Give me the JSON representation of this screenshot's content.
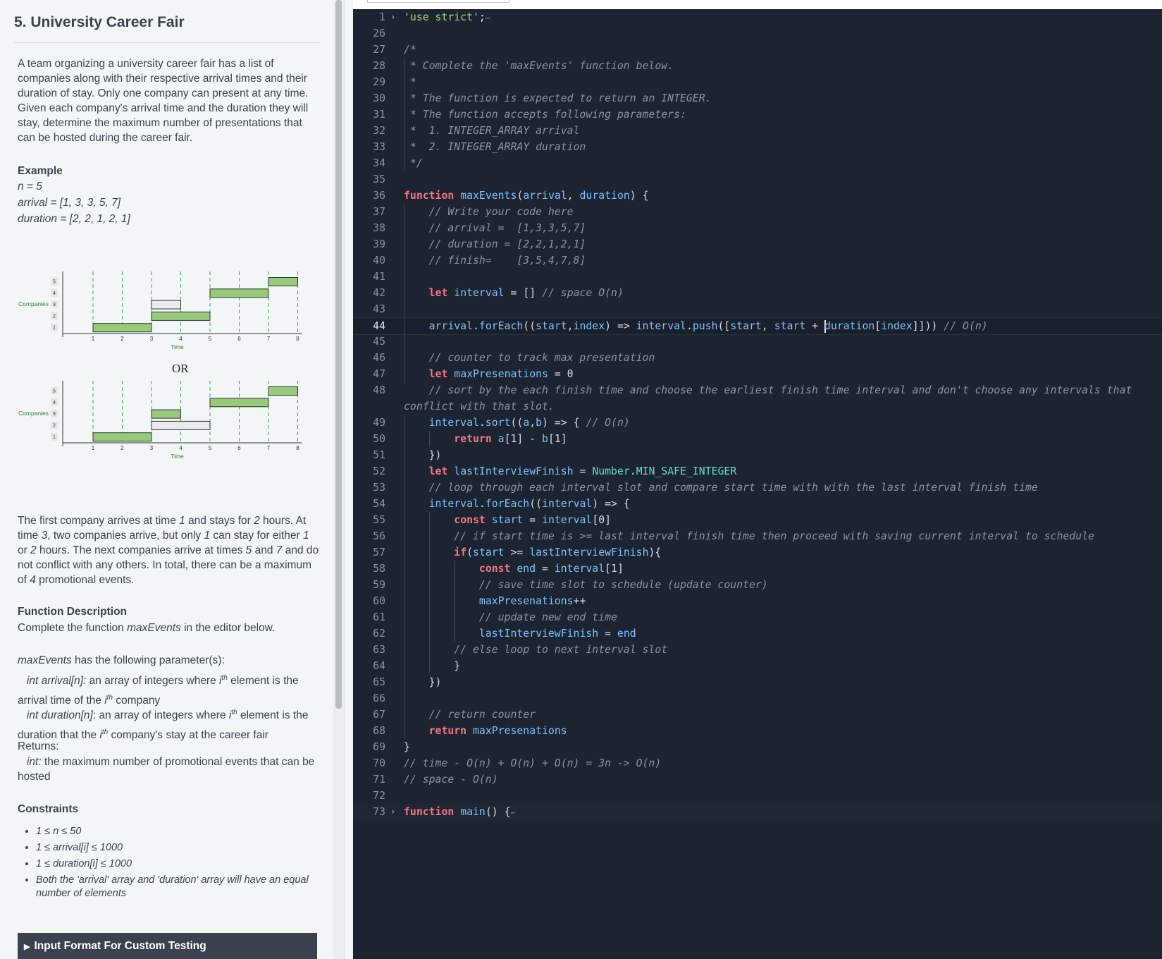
{
  "problem": {
    "title": "5. University Career Fair",
    "intro": "A team organizing a university career fair has a list of companies along with their respective arrival times and their duration of stay. Only one company can present at any time. Given each company's arrival time and the duration they will stay, determine the maximum number of presentations that can be hosted during the career fair.",
    "example_heading": "Example",
    "example_n": "n = 5",
    "example_arrival": "arrival = [1, 3, 3, 5, 7]",
    "example_duration": "duration = [2, 2, 1, 2, 1]",
    "chart_ylabel": "Companies",
    "chart_xlabel": "Time",
    "chart_or": "OR",
    "chart_ticks_x": [
      "1",
      "2",
      "3",
      "4",
      "5",
      "6",
      "7",
      "8"
    ],
    "chart_ticks_y": [
      "1",
      "2",
      "3",
      "4",
      "5"
    ],
    "explanation": {
      "p1": "The first company arrives at time ",
      "v1": "1",
      "p2": " and stays for ",
      "v2": "2",
      "p3": " hours. At time ",
      "v3": "3",
      "p4": ", two companies arrive, but only ",
      "v4": "1",
      "p5": " can stay for either ",
      "v5": "1",
      "p6": " or ",
      "v6": "2",
      "p7": " hours. The next companies arrive at times ",
      "v7": "5",
      "p8": " and ",
      "v8": "7",
      "p9": " and do not conflict with any others. In total, there can be a maximum of ",
      "v9": "4",
      "p10": " promotional events."
    },
    "func_desc_heading": "Function Description",
    "func_desc_pre": "Complete the function ",
    "func_desc_name": "maxEvents",
    "func_desc_post": " in the editor below.",
    "params_name": "maxEvents",
    "params_post": " has the following parameter(s):",
    "param1_sig": "int arrival[n]:",
    "param1_a": "  an array of integers where ",
    "param1_i": "i",
    "param1_sup": "th",
    "param1_b": " element is the arrival time of the ",
    "param1_c": " company",
    "param2_sig": "int duration[n]",
    "param2_colon": ":",
    "param2_a": "  an array of integers where ",
    "param2_b": " element is the duration that the ",
    "param2_c": " company's stay at the career fair",
    "returns_label": "Returns:",
    "returns_sig": "int:",
    "returns_text": " the maximum number of promotional events that can be hosted",
    "constraints_heading": "Constraints",
    "constraints": [
      "1 ≤ n ≤ 50",
      "1  ≤ arrival[i] ≤ 1000",
      "1 ≤ duration[i] ≤ 1000",
      "Both the 'arrival' array and 'duration' array will have an equal number of elements"
    ],
    "input_format_label": "Input Format For Custom Testing"
  },
  "editor": {
    "line_numbers": [
      "1",
      "26",
      "27",
      "28",
      "29",
      "30",
      "31",
      "32",
      "33",
      "34",
      "35",
      "36",
      "37",
      "38",
      "39",
      "40",
      "41",
      "42",
      "43",
      "44",
      "45",
      "46",
      "47",
      "48",
      "49",
      "50",
      "51",
      "52",
      "53",
      "54",
      "55",
      "56",
      "57",
      "58",
      "59",
      "60",
      "61",
      "62",
      "63",
      "64",
      "65",
      "66",
      "67",
      "68",
      "69",
      "70",
      "71",
      "72",
      "73"
    ],
    "current_line": "44",
    "fold_marker": "›",
    "ellipsis": "⋯"
  },
  "colors": {
    "editor_bg": "#1c2431",
    "keyword": "#f77583",
    "identifier": "#7ec2ff",
    "comment": "#8a93a4",
    "string": "#a9dc76",
    "constant": "#5ee0c4",
    "bar_fill": "#97cb7a",
    "panel_bg": "#f3f6f7"
  }
}
